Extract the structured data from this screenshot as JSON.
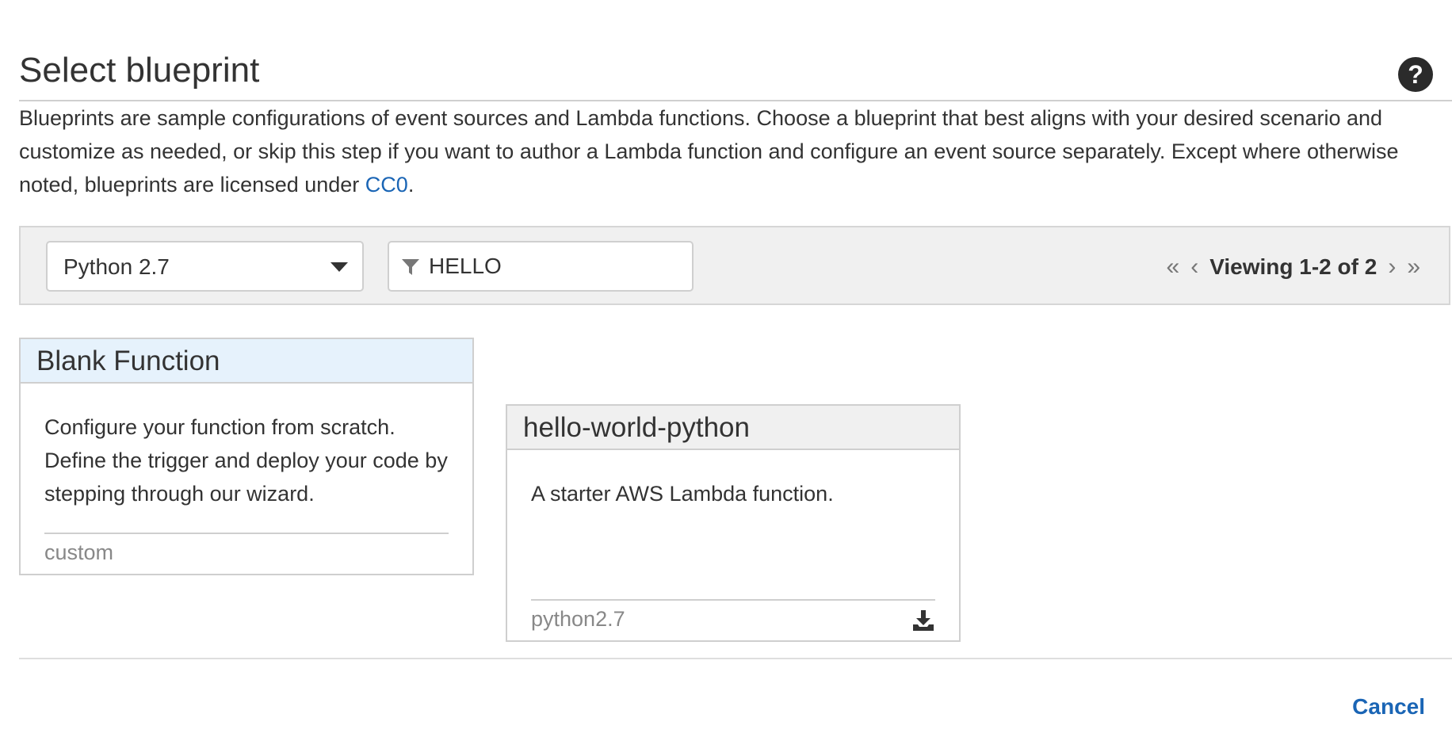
{
  "header": {
    "title": "Select blueprint",
    "help_icon": "help-icon"
  },
  "description": {
    "text": "Blueprints are sample configurations of event sources and Lambda functions. Choose a blueprint that best aligns with your desired scenario and customize as needed, or skip this step if you want to author a Lambda function and configure an event source separately. Except where otherwise noted, blueprints are licensed under ",
    "link_label": "CC0",
    "suffix": "."
  },
  "toolbar": {
    "runtime_value": "Python 2.7",
    "filter_value": "HELLO",
    "pager": {
      "first": "«",
      "prev": "‹",
      "viewing": "Viewing 1-2 of 2",
      "next": "›",
      "last": "»"
    }
  },
  "cards": [
    {
      "title": "Blank Function",
      "body": "Configure your function from scratch. Define the trigger and deploy your code by stepping through our wizard.",
      "tag": "custom"
    },
    {
      "title": "hello-world-python",
      "body": "A starter AWS Lambda function.",
      "tag": "python2.7",
      "icon": "download-icon"
    }
  ],
  "footer": {
    "cancel_label": "Cancel"
  },
  "colors": {
    "link": "#1a65b5",
    "selected_header": "#e6f2fc",
    "toolbar_bg": "#f0f0f0"
  }
}
